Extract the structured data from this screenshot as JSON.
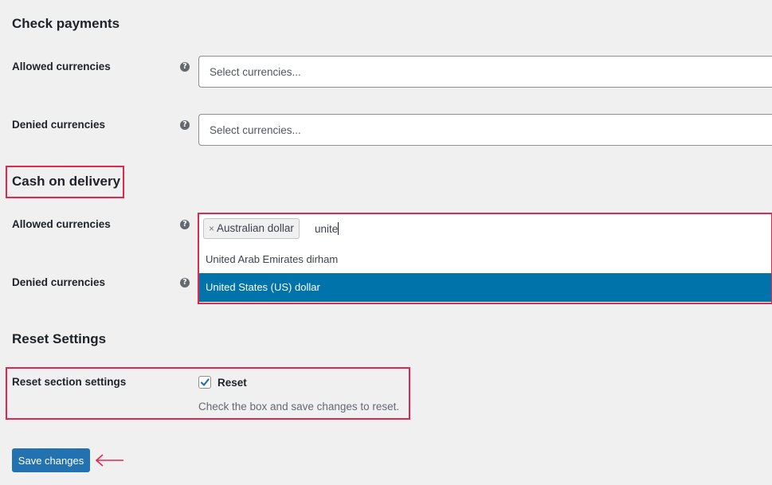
{
  "sections": {
    "check_payments": {
      "title": "Check payments",
      "allowed_label": "Allowed currencies",
      "allowed_placeholder": "Select currencies...",
      "denied_label": "Denied currencies",
      "denied_placeholder": "Select currencies..."
    },
    "cash_on_delivery": {
      "title": "Cash on delivery",
      "allowed_label": "Allowed currencies",
      "selected_chip": "Australian dollar",
      "chip_remove": "×",
      "search_value": "unite",
      "options": [
        {
          "label": "United Arab Emirates dirham",
          "highlighted": false
        },
        {
          "label": "United States (US) dollar",
          "highlighted": true
        }
      ],
      "denied_label": "Denied currencies"
    },
    "reset_settings": {
      "title": "Reset Settings",
      "row_label": "Reset section settings",
      "checkbox_label": "Reset",
      "checked": true,
      "description": "Check the box and save changes to reset."
    }
  },
  "help_icon_glyph": "?",
  "save_button": "Save changes",
  "colors": {
    "accent": "#2271b1",
    "highlight": "#0073aa",
    "annotation": "#e0284f"
  }
}
